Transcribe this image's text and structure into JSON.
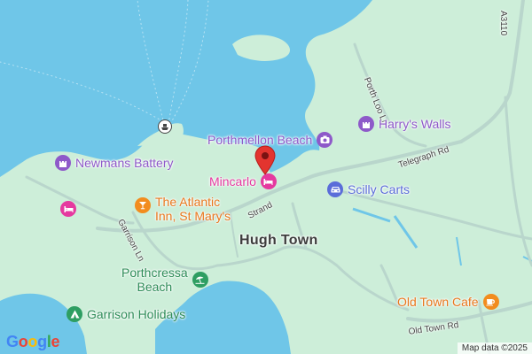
{
  "map": {
    "water_color": "#6fc6e8",
    "land_color": "#cdeed9",
    "road_color": "#b9d6cc",
    "town_label": "Hugh Town",
    "roads": {
      "a3110": "A3110",
      "porth_loo_ln": "Porth Loo Ln",
      "telegraph_rd": "Telegraph Rd",
      "strand": "Strand",
      "garrison_ln": "Garrison Ln",
      "old_town_rd": "Old Town Rd"
    },
    "places": {
      "porthmellon_beach": {
        "label": "Porthmellon Beach",
        "icon": "camera-icon",
        "color": "#8e59c9"
      },
      "harrys_walls": {
        "label": "Harry's Walls",
        "icon": "castle-icon",
        "color": "#8e59c9"
      },
      "newmans_battery": {
        "label": "Newmans Battery",
        "icon": "castle-icon",
        "color": "#8e59c9"
      },
      "mincarlo": {
        "label": "Mincarlo",
        "icon": "bed-icon",
        "color": "#e5399f"
      },
      "unnamed_hotel": {
        "icon": "bed-icon",
        "color": "#e5399f"
      },
      "atlantic_inn_line1": "The Atlantic",
      "atlantic_inn_line2": "Inn, St Mary's",
      "atlantic_inn_icon": "cocktail-icon",
      "scilly_carts": {
        "label": "Scilly Carts",
        "icon": "car-icon",
        "color": "#5b6dd9"
      },
      "porthcressa_line1": "Porthcressa",
      "porthcressa_line2": "Beach",
      "porthcressa_icon": "beach-icon",
      "garrison_holidays": {
        "label": "Garrison Holidays",
        "icon": "camping-icon",
        "color": "#2e9e62"
      },
      "old_town_cafe": {
        "label": "Old Town Cafe",
        "icon": "coffee-icon",
        "color": "#f28c1e"
      }
    },
    "marker": {
      "icon": "location-pin-icon",
      "color": "#e3342f"
    },
    "ferry_icon": "ferry-icon",
    "attribution": "Map data ©2025",
    "logo": "Google"
  }
}
